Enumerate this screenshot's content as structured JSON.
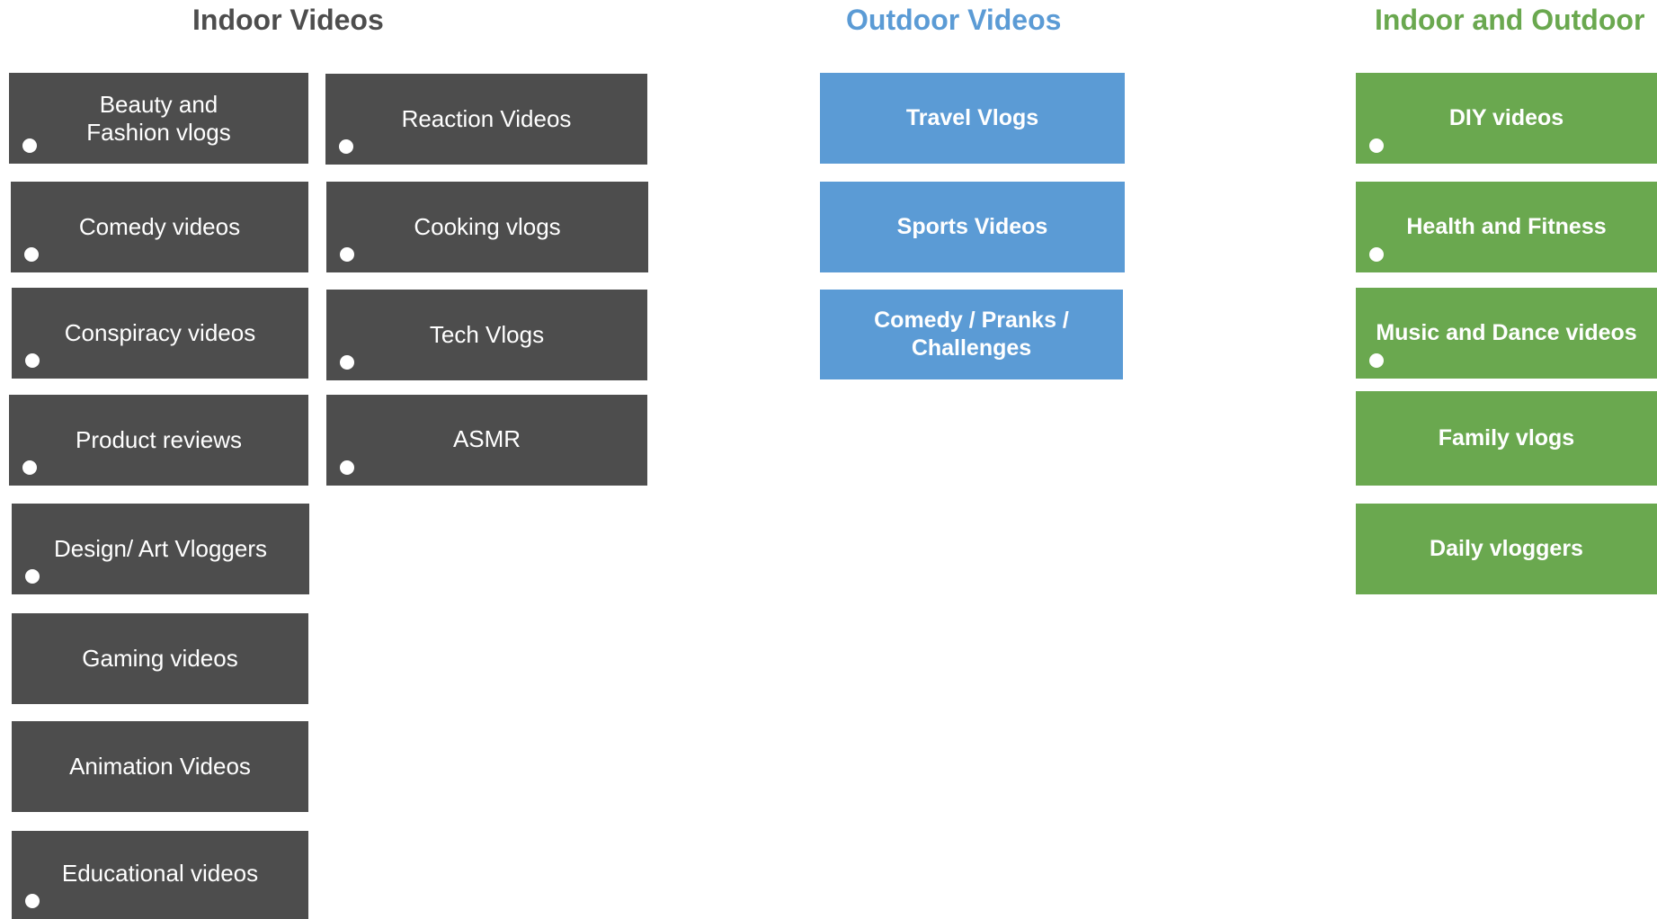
{
  "headings": {
    "indoor": "Indoor Videos",
    "outdoor": "Outdoor Videos",
    "both": "Indoor and Outdoor"
  },
  "indoor": {
    "col1": [
      "Beauty and Fashion vlogs",
      "Comedy videos",
      "Conspiracy videos",
      "Product reviews",
      "Design/ Art Vloggers",
      "Gaming videos",
      "Animation Videos",
      "Educational videos"
    ],
    "col2": [
      "Reaction Videos",
      "Cooking vlogs",
      "Tech Vlogs",
      "ASMR"
    ]
  },
  "outdoor": {
    "items": [
      "Travel Vlogs",
      "Sports Videos",
      "Comedy / Pranks / Challenges"
    ]
  },
  "both": {
    "items": [
      "DIY videos",
      "Health and Fitness",
      "Music and Dance videos",
      "Family vlogs",
      "Daily vloggers"
    ]
  },
  "colors": {
    "indoor": "#4d4d4d",
    "outdoor": "#5b9bd5",
    "both": "#6aa84f"
  }
}
